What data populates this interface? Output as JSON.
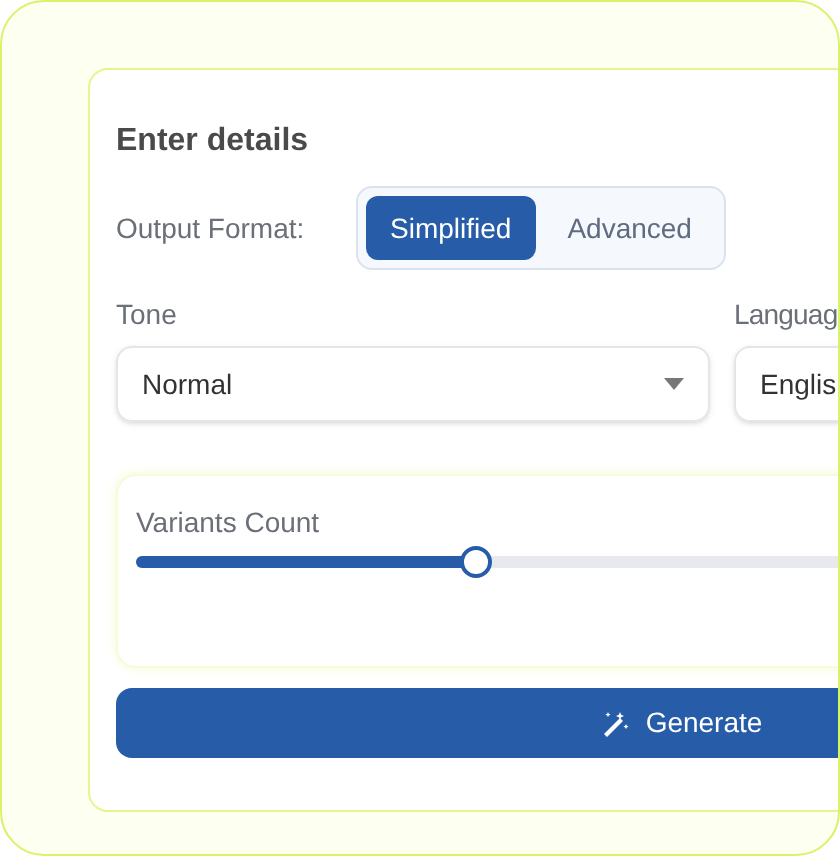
{
  "title": "Enter details",
  "output_format": {
    "label": "Output Format:",
    "options": [
      {
        "label": "Simplified",
        "selected": true
      },
      {
        "label": "Advanced",
        "selected": false
      }
    ]
  },
  "tone": {
    "label": "Tone",
    "value": "Normal"
  },
  "language": {
    "label": "Languag",
    "value": "Englis"
  },
  "variants": {
    "label": "Variants Count",
    "level": 0.34
  },
  "generate": {
    "label": "Generate"
  }
}
